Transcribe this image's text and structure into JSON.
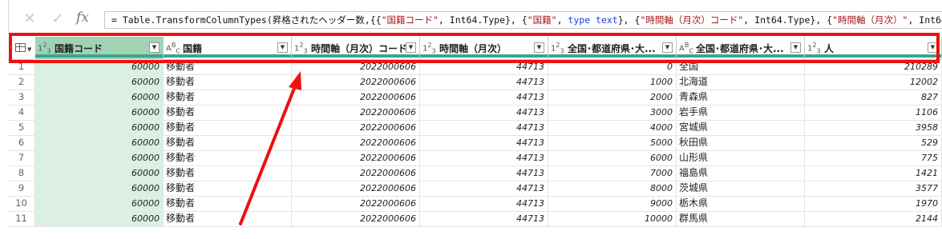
{
  "formula_bar": {
    "cancel_icon": "close-icon",
    "confirm_icon": "check-icon",
    "fx_label": "fx",
    "formula_prefix": "= Table.TransformColumnTypes(昇格されたヘッダー数,{{",
    "formula_s1": "\"国籍コード\"",
    "formula_p1": ", Int64.Type}, {",
    "formula_s2": "\"国籍\"",
    "formula_p2": ", ",
    "formula_kw1": "type text",
    "formula_p3": "}, {",
    "formula_s3": "\"時間軸（月次）コード\"",
    "formula_p4": ", Int64.Type}, {",
    "formula_s4": "\"時間軸（月次）\"",
    "formula_p5": ", Int64.T"
  },
  "columns": [
    {
      "type": "int",
      "name": "国籍コード",
      "selected": true
    },
    {
      "type": "text",
      "name": "国籍"
    },
    {
      "type": "int",
      "name": "時間軸（月次）コード"
    },
    {
      "type": "int",
      "name": "時間軸（月次）"
    },
    {
      "type": "int",
      "name": "全国･都道府県･大..."
    },
    {
      "type": "text",
      "name": "全国･都道府県･大..."
    },
    {
      "type": "int",
      "name": "人"
    }
  ],
  "rows": [
    [
      "1",
      "60000",
      "移動者",
      "2022000606",
      "44713",
      "0",
      "全国",
      "210289"
    ],
    [
      "2",
      "60000",
      "移動者",
      "2022000606",
      "44713",
      "1000",
      "北海道",
      "12002"
    ],
    [
      "3",
      "60000",
      "移動者",
      "2022000606",
      "44713",
      "2000",
      "青森県",
      "827"
    ],
    [
      "4",
      "60000",
      "移動者",
      "2022000606",
      "44713",
      "3000",
      "岩手県",
      "1106"
    ],
    [
      "5",
      "60000",
      "移動者",
      "2022000606",
      "44713",
      "4000",
      "宮城県",
      "3958"
    ],
    [
      "6",
      "60000",
      "移動者",
      "2022000606",
      "44713",
      "5000",
      "秋田県",
      "529"
    ],
    [
      "7",
      "60000",
      "移動者",
      "2022000606",
      "44713",
      "6000",
      "山形県",
      "775"
    ],
    [
      "8",
      "60000",
      "移動者",
      "2022000606",
      "44713",
      "7000",
      "福島県",
      "1421"
    ],
    [
      "9",
      "60000",
      "移動者",
      "2022000606",
      "44713",
      "8000",
      "茨城県",
      "3577"
    ],
    [
      "10",
      "60000",
      "移動者",
      "2022000606",
      "44713",
      "9000",
      "栃木県",
      "1970"
    ],
    [
      "11",
      "60000",
      "移動者",
      "2022000606",
      "44713",
      "10000",
      "群馬県",
      "2144"
    ]
  ],
  "colors": {
    "selected_header": "#9fd3b4",
    "selected_cells": "#dcefe3",
    "quality_bar": "#3ca58c",
    "annotation": "#ee1111"
  }
}
